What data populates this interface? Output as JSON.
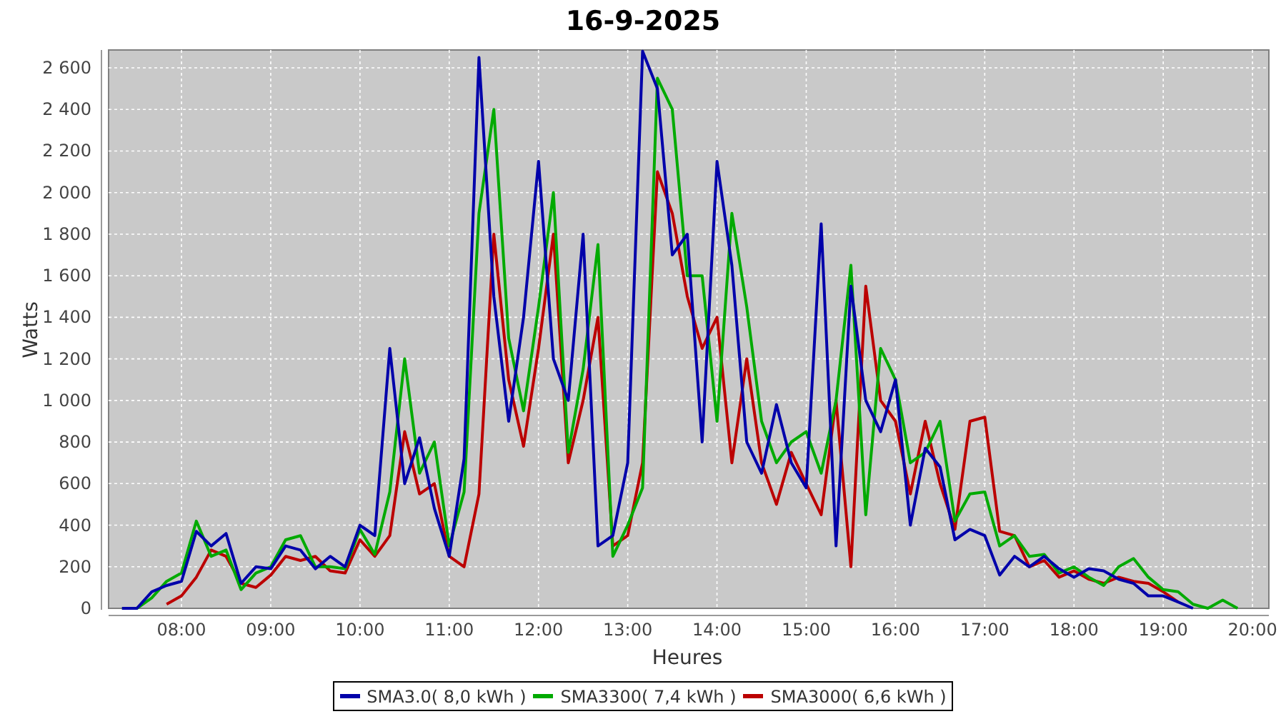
{
  "chart_data": {
    "type": "line",
    "grid": true,
    "legend": true,
    "title": "16-9-2025",
    "xlabel": "Heures",
    "ylabel": "Watts",
    "x": [
      440,
      450,
      460,
      470,
      480,
      490,
      500,
      510,
      520,
      530,
      540,
      550,
      560,
      570,
      580,
      590,
      600,
      610,
      620,
      630,
      640,
      650,
      660,
      670,
      680,
      690,
      700,
      710,
      720,
      730,
      740,
      750,
      760,
      770,
      780,
      790,
      800,
      810,
      820,
      830,
      840,
      850,
      860,
      870,
      880,
      890,
      900,
      910,
      920,
      930,
      940,
      950,
      960,
      970,
      980,
      990,
      1000,
      1010,
      1020,
      1030,
      1040,
      1050,
      1060,
      1070,
      1080,
      1090,
      1100,
      1110,
      1120,
      1130,
      1140,
      1150,
      1160,
      1170,
      1180,
      1190
    ],
    "series": [
      {
        "name": "SMA3.0( 8,0 kWh )",
        "color": "#0000aa",
        "values": [
          0,
          0,
          80,
          110,
          130,
          370,
          300,
          360,
          120,
          200,
          190,
          300,
          280,
          190,
          250,
          200,
          400,
          350,
          1250,
          600,
          820,
          480,
          250,
          720,
          2650,
          1500,
          900,
          1400,
          2150,
          1200,
          1000,
          1800,
          300,
          350,
          700,
          2680,
          2500,
          1700,
          1800,
          800,
          2150,
          1650,
          800,
          650,
          980,
          700,
          580,
          1850,
          300,
          1550,
          1000,
          850,
          1100,
          400,
          770,
          680,
          330,
          380,
          350,
          160,
          250,
          200,
          250,
          190,
          150,
          190,
          180,
          140,
          120,
          60,
          60,
          30,
          0,
          null,
          null,
          null
        ]
      },
      {
        "name": "SMA3300( 7,4 kWh )",
        "color": "#00aa00",
        "values": [
          0,
          0,
          50,
          130,
          170,
          420,
          250,
          280,
          90,
          170,
          200,
          330,
          350,
          200,
          200,
          190,
          380,
          260,
          560,
          1200,
          650,
          800,
          300,
          560,
          1900,
          2400,
          1300,
          950,
          1450,
          2000,
          750,
          1150,
          1750,
          250,
          400,
          580,
          2550,
          2400,
          1600,
          1600,
          900,
          1900,
          1450,
          900,
          700,
          800,
          850,
          650,
          1000,
          1650,
          450,
          1250,
          1100,
          700,
          750,
          900,
          420,
          550,
          560,
          300,
          350,
          250,
          260,
          170,
          200,
          150,
          110,
          200,
          240,
          150,
          90,
          80,
          20,
          0,
          40,
          0
        ]
      },
      {
        "name": "SMA3000( 6,6 kWh )",
        "color": "#bb0000",
        "values": [
          null,
          null,
          null,
          20,
          60,
          150,
          280,
          250,
          120,
          100,
          160,
          250,
          230,
          250,
          180,
          170,
          330,
          250,
          350,
          850,
          550,
          600,
          250,
          200,
          550,
          1800,
          1100,
          780,
          1250,
          1800,
          700,
          1000,
          1400,
          300,
          350,
          700,
          2100,
          1900,
          1500,
          1250,
          1400,
          700,
          1200,
          700,
          500,
          750,
          600,
          450,
          1000,
          200,
          1550,
          1000,
          900,
          550,
          900,
          600,
          380,
          900,
          920,
          370,
          350,
          200,
          230,
          150,
          180,
          140,
          120,
          150,
          130,
          120,
          80,
          30,
          null,
          null,
          null,
          null
        ]
      }
    ],
    "xlim": [
      431,
      1211
    ],
    "ylim": [
      0,
      2686
    ],
    "xticks": [
      {
        "value": 480,
        "label": "08:00"
      },
      {
        "value": 540,
        "label": "09:00"
      },
      {
        "value": 600,
        "label": "10:00"
      },
      {
        "value": 660,
        "label": "11:00"
      },
      {
        "value": 720,
        "label": "12:00"
      },
      {
        "value": 780,
        "label": "13:00"
      },
      {
        "value": 840,
        "label": "14:00"
      },
      {
        "value": 900,
        "label": "15:00"
      },
      {
        "value": 960,
        "label": "16:00"
      },
      {
        "value": 1020,
        "label": "17:00"
      },
      {
        "value": 1080,
        "label": "18:00"
      },
      {
        "value": 1140,
        "label": "19:00"
      },
      {
        "value": 1200,
        "label": "20:00"
      }
    ],
    "yticks": [
      {
        "value": 0,
        "label": "0"
      },
      {
        "value": 200,
        "label": "200"
      },
      {
        "value": 400,
        "label": "400"
      },
      {
        "value": 600,
        "label": "600"
      },
      {
        "value": 800,
        "label": "800"
      },
      {
        "value": 1000,
        "label": "1 000"
      },
      {
        "value": 1200,
        "label": "1 200"
      },
      {
        "value": 1400,
        "label": "1 400"
      },
      {
        "value": 1600,
        "label": "1 600"
      },
      {
        "value": 1800,
        "label": "1 800"
      },
      {
        "value": 2000,
        "label": "2 000"
      },
      {
        "value": 2200,
        "label": "2 200"
      },
      {
        "value": 2400,
        "label": "2 400"
      },
      {
        "value": 2600,
        "label": "2 600"
      }
    ]
  }
}
